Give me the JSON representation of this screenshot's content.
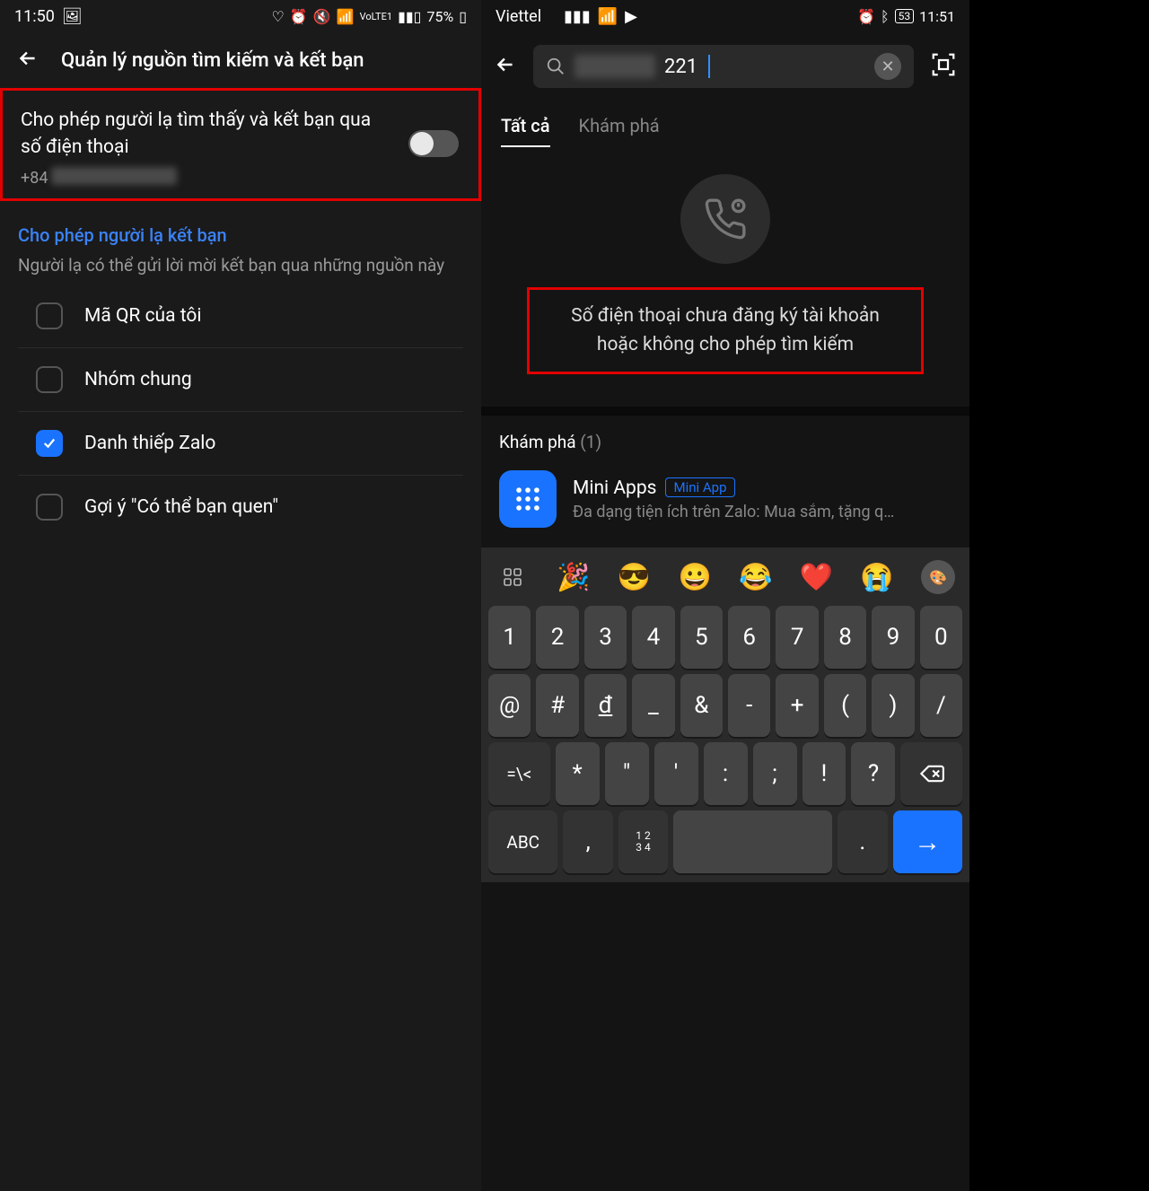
{
  "left": {
    "status": {
      "time": "11:50",
      "battery": "75%"
    },
    "header_title": "Quản lý nguồn tìm kiếm và kết bạn",
    "toggle_label": "Cho phép người lạ tìm thấy và kết bạn qua số điện thoại",
    "toggle_phone": "+84",
    "section_heading": "Cho phép người lạ kết bạn",
    "section_sub": "Người lạ có thể gửi lời mời kết bạn qua những nguồn này",
    "options": [
      {
        "label": "Mã QR của tôi",
        "checked": false
      },
      {
        "label": "Nhóm chung",
        "checked": false
      },
      {
        "label": "Danh thiếp Zalo",
        "checked": true
      },
      {
        "label": "Gợi ý \"Có thể bạn quen\"",
        "checked": false
      }
    ]
  },
  "right": {
    "status": {
      "carrier": "Viettel",
      "battery": "53",
      "time": "11:51"
    },
    "search_value": "221",
    "tabs": [
      {
        "label": "Tất cả",
        "active": true
      },
      {
        "label": "Khám phá",
        "active": false
      }
    ],
    "result_msg_l1": "Số điện thoại chưa đăng ký tài khoản",
    "result_msg_l2": "hoặc không cho phép tìm kiếm",
    "discover_heading": "Khám phá",
    "discover_count": "(1)",
    "mini_app": {
      "title": "Mini Apps",
      "badge": "Mini App",
      "desc": "Đa dạng tiện ích trên Zalo: Mua sắm, tặng q…"
    },
    "emoji": [
      "🎉",
      "😎",
      "😀",
      "😂",
      "❤️",
      "😭"
    ],
    "kbd_rows": {
      "r1": [
        "1",
        "2",
        "3",
        "4",
        "5",
        "6",
        "7",
        "8",
        "9",
        "0"
      ],
      "r2": [
        "@",
        "#",
        "đ",
        "_",
        "&",
        "-",
        "+",
        "(",
        ")",
        "/"
      ],
      "r3_mid": [
        "*",
        "\"",
        "'",
        ":",
        ";",
        "!",
        "?"
      ],
      "r4": {
        "abc": "ABC",
        "comma": ",",
        "numgrid": "1 2\n3 4",
        "dot": "."
      }
    }
  }
}
